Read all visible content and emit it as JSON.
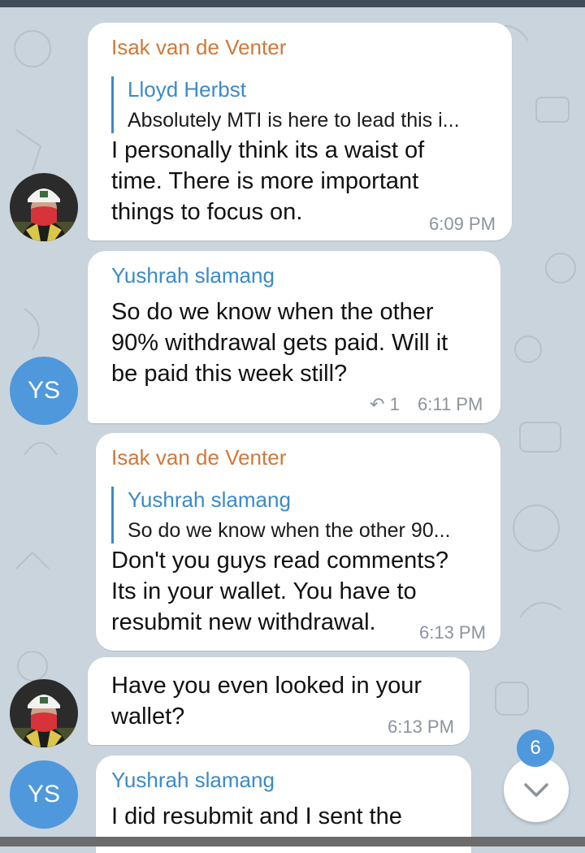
{
  "messages": [
    {
      "sender": "Isak van de Venter",
      "reply_to": {
        "name": "Lloyd Herbst",
        "text": "Absolutely MTI is here to lead this i..."
      },
      "lines": [
        "I personally think its a waist of",
        "time. There is more important",
        "things to focus on."
      ],
      "time": "6:09 PM"
    },
    {
      "sender": "Yushrah slamang",
      "lines": [
        "So do we know when the other",
        "90% withdrawal gets paid. Will it",
        "be paid this week still?"
      ],
      "replies_count": "1",
      "time": "6:11 PM"
    },
    {
      "sender": "Isak van de Venter",
      "reply_to": {
        "name": "Yushrah slamang",
        "text": "So do we know when the other 90..."
      },
      "lines": [
        "Don't you guys read comments?",
        "Its in your wallet. You have to",
        "resubmit new withdrawal."
      ],
      "time": "6:13 PM"
    },
    {
      "lines": [
        "Have you even looked in your",
        "wallet?"
      ],
      "time": "6:13 PM"
    },
    {
      "sender": "Yushrah slamang",
      "lines": [
        "I did resubmit and I sent the"
      ]
    }
  ],
  "avatars": {
    "ys_initials": "YS"
  },
  "scroll_button": {
    "unread_count": "6",
    "icon": "chevron-down-icon"
  },
  "colors": {
    "sender_orange": "#d0783a",
    "sender_blue": "#3a8ac8",
    "avatar_blue": "#4f98dc",
    "background": "#c9d4dd"
  }
}
